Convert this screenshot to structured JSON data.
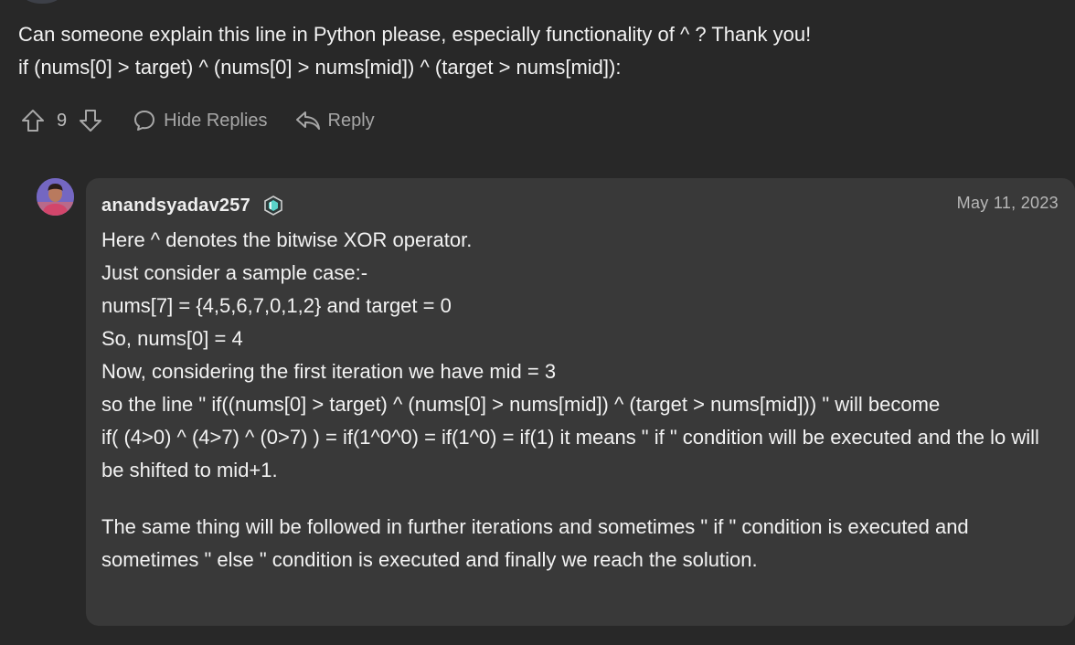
{
  "question": {
    "lines": [
      "Can someone explain this line in Python please, especially functionality of ^ ? Thank you!",
      "if (nums[0] > target) ^ (nums[0] > nums[mid]) ^ (target > nums[mid]):"
    ]
  },
  "actions": {
    "upvote_icon": "arrow-up-icon",
    "vote_count": "9",
    "downvote_icon": "arrow-down-icon",
    "hide_replies_icon": "speech-bubble-icon",
    "hide_replies_label": "Hide Replies",
    "reply_icon": "reply-arrow-icon",
    "reply_label": "Reply"
  },
  "reply": {
    "author": "anandsyadav257",
    "badge_icon": "level-badge-icon",
    "date": "May 11, 2023",
    "paragraph1": [
      "Here ^ denotes the bitwise XOR operator.",
      "Just consider a sample case:-",
      "nums[7] = {4,5,6,7,0,1,2} and target = 0",
      "So, nums[0] = 4",
      "Now, considering the first iteration we have mid = 3",
      "so the line \" if((nums[0] > target) ^ (nums[0] > nums[mid]) ^ (target > nums[mid])) \" will become",
      "if( (4>0) ^ (4>7) ^ (0>7) ) = if(1^0^0) = if(1^0) = if(1) it means \" if \" condition will be executed and the lo will be shifted to mid+1."
    ],
    "paragraph2": "The same thing will be followed in further iterations and sometimes \" if \" condition is executed and sometimes \" else \" condition is executed and finally we reach the solution."
  },
  "colors": {
    "background": "#282828",
    "card": "#393939",
    "text": "#f2f2f2",
    "muted": "#a7a7a7",
    "badge_accent": "#59d3c9"
  }
}
